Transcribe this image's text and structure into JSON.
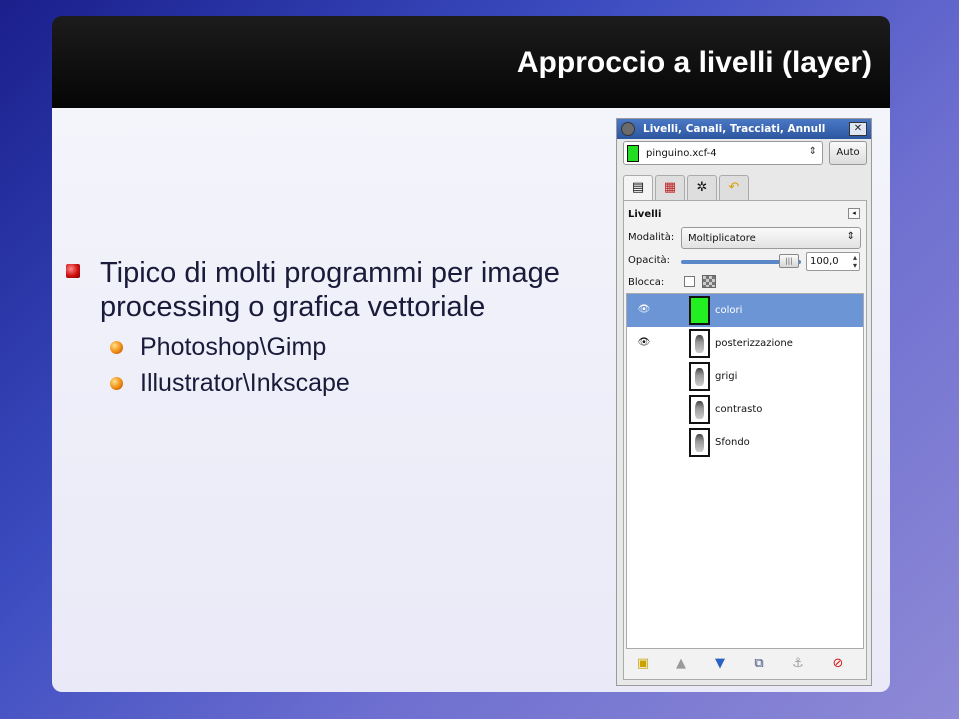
{
  "slide": {
    "title": "Approccio a livelli (layer)",
    "bullet_main": "Tipico di molti programmi per image processing o grafica vettoriale",
    "sub_bullets": [
      "Photoshop\\Gimp",
      "Illustrator\\Inkscape"
    ]
  },
  "gimp_dialog": {
    "title": "Livelli, Canali, Tracciati, Annull",
    "close_icon": "close-icon",
    "image_menu_value": "pinguino.xcf-4",
    "auto_label": "Auto",
    "tabs": [
      {
        "icon": "layers-tab-icon",
        "active": true
      },
      {
        "icon": "channels-tab-icon",
        "active": false
      },
      {
        "icon": "paths-tab-icon",
        "active": false
      },
      {
        "icon": "undo-history-tab-icon",
        "active": false
      }
    ],
    "panel_title": "Livelli",
    "mode_label": "Modalità:",
    "mode_value": "Moltiplicatore",
    "opacity_label": "Opacità:",
    "opacity_value": "100,0",
    "lock_label": "Blocca:",
    "layers": [
      {
        "name": "colori",
        "visible": true,
        "selected": true,
        "thumb": "green"
      },
      {
        "name": "posterizzazione",
        "visible": true,
        "selected": false,
        "thumb": "penguin"
      },
      {
        "name": "grigi",
        "visible": false,
        "selected": false,
        "thumb": "penguin"
      },
      {
        "name": "contrasto",
        "visible": false,
        "selected": false,
        "thumb": "penguin"
      },
      {
        "name": "Sfondo",
        "visible": false,
        "selected": false,
        "thumb": "penguin"
      }
    ],
    "bottom_buttons": [
      "new-layer-icon",
      "raise-layer-icon",
      "lower-layer-icon",
      "duplicate-layer-icon",
      "anchor-layer-icon",
      "delete-layer-icon"
    ]
  }
}
